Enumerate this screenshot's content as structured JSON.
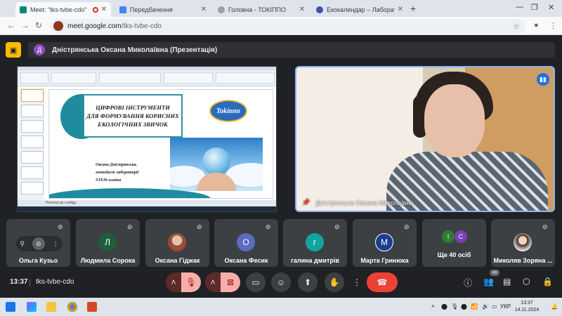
{
  "browser": {
    "tabs": [
      {
        "title": "Meet: \"tks-tvbe-cdo\"",
        "active": true
      },
      {
        "title": "Передбачення",
        "active": false
      },
      {
        "title": "Головна - ТОКІППО",
        "active": false
      },
      {
        "title": "Екокалендар – Лабораторія STEM",
        "active": false
      }
    ],
    "address": {
      "host": "meet.google.com",
      "path": "/tks-tvbe-cdo"
    }
  },
  "meet": {
    "presenter_chip": {
      "avatar_letter": "Д",
      "text": "Дністрянська Оксана Миколаївна (Презентація)"
    },
    "slide": {
      "title_lines": [
        "ЦИФРОВІ ІНСТРУМЕНТИ",
        "ДЛЯ ФОРМУВАННЯ КОРИСНИХ",
        "ЕКОЛОГІЧНИХ ЗВИЧОК"
      ],
      "logo_text": "Tokinno",
      "author_lines": [
        "Оксана Дністрянська,",
        "методист лабораторії",
        "STEM-освіти"
      ],
      "status": "Нотатки до слайду"
    },
    "main_video": {
      "name": "Дністрянська Оксана Миколаївна"
    },
    "participants": [
      {
        "name": "Ольга Кузьо",
        "type": "controls"
      },
      {
        "name": "Людмила Сорока",
        "type": "letter",
        "letter": "Л",
        "color": "#1e5e3a"
      },
      {
        "name": "Оксана Гіджак",
        "type": "photo",
        "color": "#d9a7a0"
      },
      {
        "name": "Оксана Фесик",
        "type": "letter",
        "letter": "О",
        "color": "#5c6bc0"
      },
      {
        "name": "галина дмитрів",
        "type": "letter",
        "letter": "г",
        "color": "#12a5a0"
      },
      {
        "name": "Марта Гринюка",
        "type": "letter",
        "letter": "M",
        "color": "#1a3f8f"
      },
      {
        "name": "Ще 40 осіб",
        "type": "more",
        "letters": [
          "І",
          "С"
        ]
      },
      {
        "name": "Миколяв Зоряна ...",
        "type": "photo",
        "color": "#e9c9a8"
      }
    ],
    "bottom": {
      "time": "13:37",
      "code": "tks-tvbe-cdo",
      "people_count": "49"
    }
  },
  "taskbar": {
    "lang": "УКР",
    "time": "13:37",
    "date": "14.11.2024"
  },
  "colors": {
    "meet_bg": "#202124",
    "tile_bg": "#3c4043",
    "leave_red": "#ea4335",
    "speaker_outline": "#8ab4f8"
  }
}
